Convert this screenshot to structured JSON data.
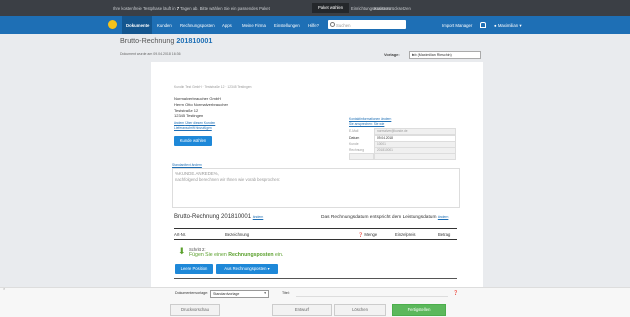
{
  "trial_bar": {
    "msg_pre": "Ihre kostenfreie Testphase läuft in",
    "days": "7",
    "msg_post": "Tagen ab. Bitte wählen Sie ein passendes Paket",
    "package_button": "Paket wählen",
    "assistant_link": "Einrichtungsassistent",
    "cancel_link": "Konto zurücksetzen"
  },
  "nav": {
    "items": [
      "Dokumente",
      "Kunden",
      "Rechnungsposten",
      "Apps",
      "Meine Firma",
      "Einstellungen",
      "Hilfe?"
    ],
    "search_placeholder": "Suchen",
    "import_manager": "Import Manager",
    "user": "Maximilian"
  },
  "header": {
    "title": "Brutto-Rechnung",
    "number": "201810001",
    "saved_info": "Dokument wurde am 09.04.2018 16:36",
    "template_label": "Vorlage:",
    "template_value": "lcb (Maximilian Rieschin)"
  },
  "document": {
    "sender_line": "Kundin Test GmbH · Teststraße 12 · 12345 Testingen",
    "recipient": [
      "Normalverbraucher GmbH",
      "Herrn Otto Normalverbraucher",
      "Teststraße 12",
      "12345 Testingen"
    ],
    "address_links": [
      "ändern",
      "Über diesen Kunden",
      "Lieferanschrift hinzufügen"
    ],
    "choose_customer": "Kunde wählen",
    "contact_links": [
      "Kontaktinformationen ändern",
      "Sie ansprechen: Sie wie"
    ],
    "info_rows": [
      {
        "label": "E-Mail",
        "value": "normalver@kunde.de"
      },
      {
        "label": "Datum",
        "value": "09.04.2018"
      },
      {
        "label": "Kunde",
        "value": "10001"
      },
      {
        "label": "Rechnung",
        "value": "201810001"
      }
    ],
    "textblock_link": "Standardtext ändern",
    "salutation": "%KUNDE.ANREDE%,",
    "intro_text": "nachfolgend berechnen wir Ihnen wie vorab besprochen:",
    "invoice_heading": "Brutto-Rechnung 201810001",
    "heading_link": "ändern",
    "service_date_text": "Das Rechnungsdatum entspricht dem Leistungsdatum",
    "service_date_link": "ändern",
    "columns": [
      "Art-Nr.",
      "Bezeichnung",
      "Menge",
      "Einzelpreis",
      "Betrag"
    ],
    "step_label": "Schritt 2:",
    "step_text_pre": "Fügen Sie einen",
    "step_text_highlight": "Rechnungsposten",
    "step_text_post": "ein.",
    "empty_position_button": "Leere Position",
    "from_items_button": "Aus Rechnungsposten"
  },
  "bottom_bar": {
    "template_label": "Dokumentenvorlage:",
    "template_value": "Standardvorlage",
    "title_label": "Titel:",
    "print_preview": "Druckvorschau",
    "draft": "Entwurf",
    "delete": "Löschen",
    "finish": "Fertigstellen"
  },
  "colors": {
    "nav": "#1e6fb5",
    "trial_bar": "#3b3f45",
    "finish_button": "#5cb85c",
    "primary_button": "#1e88d8",
    "step_green": "#5aa02c"
  }
}
